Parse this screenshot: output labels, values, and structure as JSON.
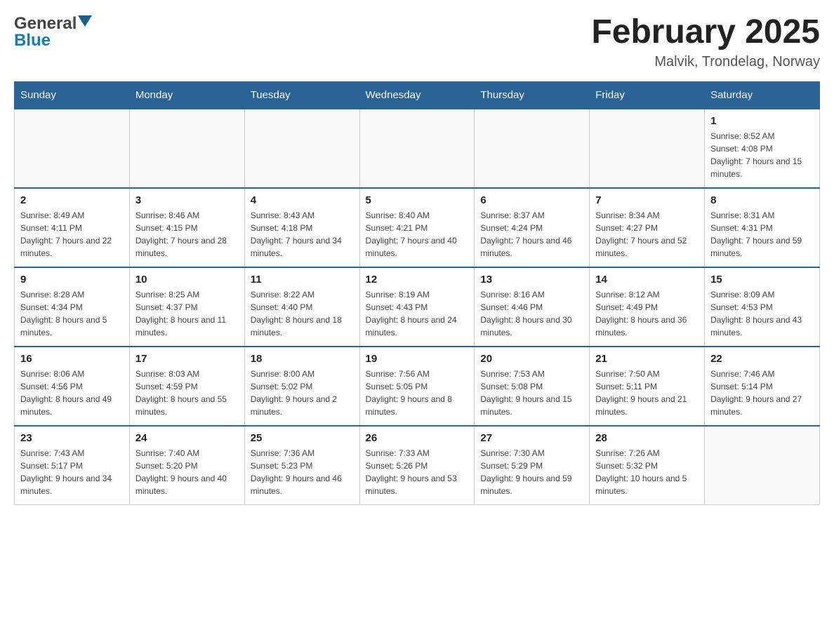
{
  "header": {
    "month_title": "February 2025",
    "location": "Malvik, Trondelag, Norway",
    "logo_general": "General",
    "logo_blue": "Blue"
  },
  "days_of_week": [
    "Sunday",
    "Monday",
    "Tuesday",
    "Wednesday",
    "Thursday",
    "Friday",
    "Saturday"
  ],
  "weeks": [
    [
      {
        "day": "",
        "info": ""
      },
      {
        "day": "",
        "info": ""
      },
      {
        "day": "",
        "info": ""
      },
      {
        "day": "",
        "info": ""
      },
      {
        "day": "",
        "info": ""
      },
      {
        "day": "",
        "info": ""
      },
      {
        "day": "1",
        "info": "Sunrise: 8:52 AM\nSunset: 4:08 PM\nDaylight: 7 hours and 15 minutes."
      }
    ],
    [
      {
        "day": "2",
        "info": "Sunrise: 8:49 AM\nSunset: 4:11 PM\nDaylight: 7 hours and 22 minutes."
      },
      {
        "day": "3",
        "info": "Sunrise: 8:46 AM\nSunset: 4:15 PM\nDaylight: 7 hours and 28 minutes."
      },
      {
        "day": "4",
        "info": "Sunrise: 8:43 AM\nSunset: 4:18 PM\nDaylight: 7 hours and 34 minutes."
      },
      {
        "day": "5",
        "info": "Sunrise: 8:40 AM\nSunset: 4:21 PM\nDaylight: 7 hours and 40 minutes."
      },
      {
        "day": "6",
        "info": "Sunrise: 8:37 AM\nSunset: 4:24 PM\nDaylight: 7 hours and 46 minutes."
      },
      {
        "day": "7",
        "info": "Sunrise: 8:34 AM\nSunset: 4:27 PM\nDaylight: 7 hours and 52 minutes."
      },
      {
        "day": "8",
        "info": "Sunrise: 8:31 AM\nSunset: 4:31 PM\nDaylight: 7 hours and 59 minutes."
      }
    ],
    [
      {
        "day": "9",
        "info": "Sunrise: 8:28 AM\nSunset: 4:34 PM\nDaylight: 8 hours and 5 minutes."
      },
      {
        "day": "10",
        "info": "Sunrise: 8:25 AM\nSunset: 4:37 PM\nDaylight: 8 hours and 11 minutes."
      },
      {
        "day": "11",
        "info": "Sunrise: 8:22 AM\nSunset: 4:40 PM\nDaylight: 8 hours and 18 minutes."
      },
      {
        "day": "12",
        "info": "Sunrise: 8:19 AM\nSunset: 4:43 PM\nDaylight: 8 hours and 24 minutes."
      },
      {
        "day": "13",
        "info": "Sunrise: 8:16 AM\nSunset: 4:46 PM\nDaylight: 8 hours and 30 minutes."
      },
      {
        "day": "14",
        "info": "Sunrise: 8:12 AM\nSunset: 4:49 PM\nDaylight: 8 hours and 36 minutes."
      },
      {
        "day": "15",
        "info": "Sunrise: 8:09 AM\nSunset: 4:53 PM\nDaylight: 8 hours and 43 minutes."
      }
    ],
    [
      {
        "day": "16",
        "info": "Sunrise: 8:06 AM\nSunset: 4:56 PM\nDaylight: 8 hours and 49 minutes."
      },
      {
        "day": "17",
        "info": "Sunrise: 8:03 AM\nSunset: 4:59 PM\nDaylight: 8 hours and 55 minutes."
      },
      {
        "day": "18",
        "info": "Sunrise: 8:00 AM\nSunset: 5:02 PM\nDaylight: 9 hours and 2 minutes."
      },
      {
        "day": "19",
        "info": "Sunrise: 7:56 AM\nSunset: 5:05 PM\nDaylight: 9 hours and 8 minutes."
      },
      {
        "day": "20",
        "info": "Sunrise: 7:53 AM\nSunset: 5:08 PM\nDaylight: 9 hours and 15 minutes."
      },
      {
        "day": "21",
        "info": "Sunrise: 7:50 AM\nSunset: 5:11 PM\nDaylight: 9 hours and 21 minutes."
      },
      {
        "day": "22",
        "info": "Sunrise: 7:46 AM\nSunset: 5:14 PM\nDaylight: 9 hours and 27 minutes."
      }
    ],
    [
      {
        "day": "23",
        "info": "Sunrise: 7:43 AM\nSunset: 5:17 PM\nDaylight: 9 hours and 34 minutes."
      },
      {
        "day": "24",
        "info": "Sunrise: 7:40 AM\nSunset: 5:20 PM\nDaylight: 9 hours and 40 minutes."
      },
      {
        "day": "25",
        "info": "Sunrise: 7:36 AM\nSunset: 5:23 PM\nDaylight: 9 hours and 46 minutes."
      },
      {
        "day": "26",
        "info": "Sunrise: 7:33 AM\nSunset: 5:26 PM\nDaylight: 9 hours and 53 minutes."
      },
      {
        "day": "27",
        "info": "Sunrise: 7:30 AM\nSunset: 5:29 PM\nDaylight: 9 hours and 59 minutes."
      },
      {
        "day": "28",
        "info": "Sunrise: 7:26 AM\nSunset: 5:32 PM\nDaylight: 10 hours and 5 minutes."
      },
      {
        "day": "",
        "info": ""
      }
    ]
  ]
}
